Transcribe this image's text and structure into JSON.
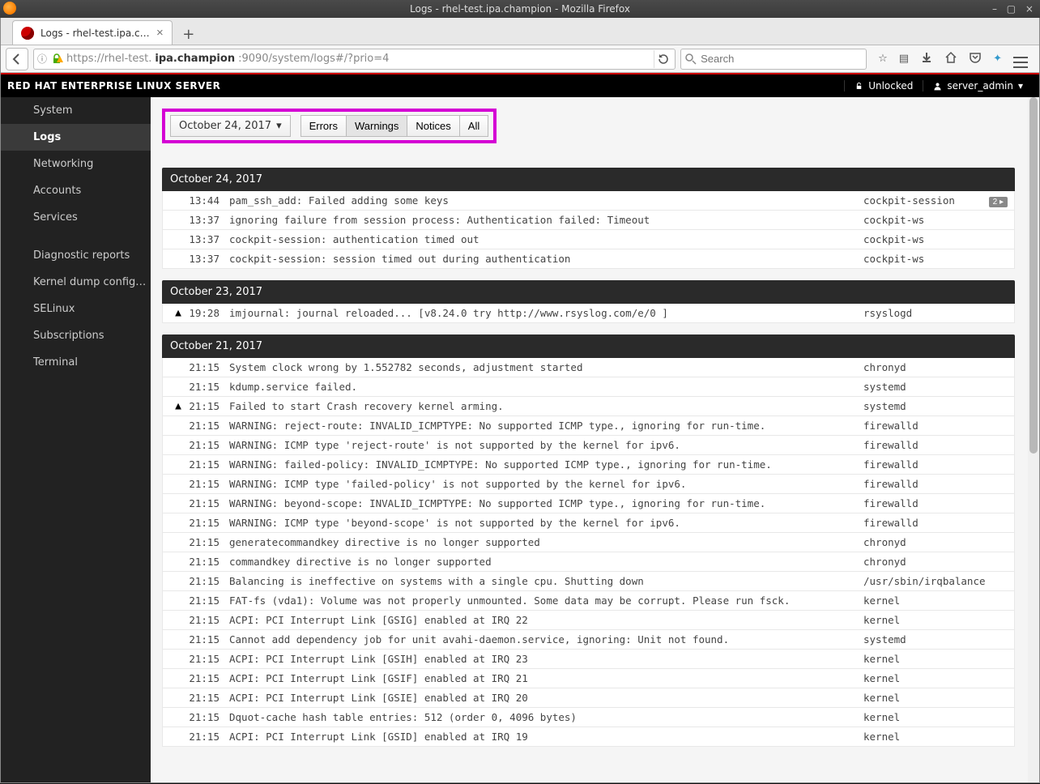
{
  "os": {
    "window_title": "Logs - rhel-test.ipa.champion - Mozilla Firefox"
  },
  "tabs": {
    "active_title": "Logs - rhel-test.ipa.cha"
  },
  "url": {
    "identity_info": "ⓘ",
    "scheme_prefix": "https://rhel-test.",
    "host_bold": "ipa.champion",
    "path_suffix": ":9090/system/logs#/?prio=4"
  },
  "search": {
    "placeholder": "Search"
  },
  "header": {
    "brand": "RED HAT ENTERPRISE LINUX SERVER",
    "lock_state": "Unlocked",
    "user": "server_admin"
  },
  "sidebar": {
    "items": [
      {
        "label": "System",
        "active": false
      },
      {
        "label": "Logs",
        "active": true
      },
      {
        "label": "Networking",
        "active": false
      },
      {
        "label": "Accounts",
        "active": false
      },
      {
        "label": "Services",
        "active": false
      }
    ],
    "items2": [
      {
        "label": "Diagnostic reports"
      },
      {
        "label": "Kernel dump configura…"
      },
      {
        "label": "SELinux"
      },
      {
        "label": "Subscriptions"
      },
      {
        "label": "Terminal"
      }
    ]
  },
  "filters": {
    "date_label": "October 24, 2017",
    "buttons": [
      "Errors",
      "Warnings",
      "Notices",
      "All"
    ]
  },
  "log_days": [
    {
      "heading": "October 24, 2017",
      "entries": [
        {
          "time": "13:44",
          "msg": "pam_ssh_add: Failed adding some keys",
          "src": "cockpit-session",
          "badge": "2 ▸"
        },
        {
          "time": "13:37",
          "msg": "ignoring failure from session process: Authentication failed: Timeout",
          "src": "cockpit-ws"
        },
        {
          "time": "13:37",
          "msg": "cockpit-session: authentication timed out",
          "src": "cockpit-ws"
        },
        {
          "time": "13:37",
          "msg": "cockpit-session: session timed out during authentication",
          "src": "cockpit-ws"
        }
      ]
    },
    {
      "heading": "October 23, 2017",
      "entries": [
        {
          "icon": "warn",
          "time": "19:28",
          "msg": "imjournal: journal reloaded... [v8.24.0 try http://www.rsyslog.com/e/0 ]",
          "src": "rsyslogd"
        }
      ]
    },
    {
      "heading": "October 21, 2017",
      "entries": [
        {
          "time": "21:15",
          "msg": "System clock wrong by 1.552782 seconds, adjustment started",
          "src": "chronyd"
        },
        {
          "time": "21:15",
          "msg": "kdump.service failed.",
          "src": "systemd"
        },
        {
          "icon": "warn",
          "time": "21:15",
          "msg": "Failed to start Crash recovery kernel arming.",
          "src": "systemd"
        },
        {
          "time": "21:15",
          "msg": "WARNING: reject-route: INVALID_ICMPTYPE: No supported ICMP type., ignoring for run-time.",
          "src": "firewalld"
        },
        {
          "time": "21:15",
          "msg": "WARNING: ICMP type 'reject-route' is not supported by the kernel for ipv6.",
          "src": "firewalld"
        },
        {
          "time": "21:15",
          "msg": "WARNING: failed-policy: INVALID_ICMPTYPE: No supported ICMP type., ignoring for run-time.",
          "src": "firewalld"
        },
        {
          "time": "21:15",
          "msg": "WARNING: ICMP type 'failed-policy' is not supported by the kernel for ipv6.",
          "src": "firewalld"
        },
        {
          "time": "21:15",
          "msg": "WARNING: beyond-scope: INVALID_ICMPTYPE: No supported ICMP type., ignoring for run-time.",
          "src": "firewalld"
        },
        {
          "time": "21:15",
          "msg": "WARNING: ICMP type 'beyond-scope' is not supported by the kernel for ipv6.",
          "src": "firewalld"
        },
        {
          "time": "21:15",
          "msg": "generatecommandkey directive is no longer supported",
          "src": "chronyd"
        },
        {
          "time": "21:15",
          "msg": "commandkey directive is no longer supported",
          "src": "chronyd"
        },
        {
          "time": "21:15",
          "msg": "Balancing is ineffective on systems with a single cpu. Shutting down",
          "src": "/usr/sbin/irqbalance"
        },
        {
          "time": "21:15",
          "msg": "FAT-fs (vda1): Volume was not properly unmounted. Some data may be corrupt. Please run fsck.",
          "src": "kernel"
        },
        {
          "time": "21:15",
          "msg": "ACPI: PCI Interrupt Link [GSIG] enabled at IRQ 22",
          "src": "kernel"
        },
        {
          "time": "21:15",
          "msg": "Cannot add dependency job for unit avahi-daemon.service, ignoring: Unit not found.",
          "src": "systemd"
        },
        {
          "time": "21:15",
          "msg": "ACPI: PCI Interrupt Link [GSIH] enabled at IRQ 23",
          "src": "kernel"
        },
        {
          "time": "21:15",
          "msg": "ACPI: PCI Interrupt Link [GSIF] enabled at IRQ 21",
          "src": "kernel"
        },
        {
          "time": "21:15",
          "msg": "ACPI: PCI Interrupt Link [GSIE] enabled at IRQ 20",
          "src": "kernel"
        },
        {
          "time": "21:15",
          "msg": "Dquot-cache hash table entries: 512 (order 0, 4096 bytes)",
          "src": "kernel"
        },
        {
          "time": "21:15",
          "msg": "ACPI: PCI Interrupt Link [GSID] enabled at IRQ 19",
          "src": "kernel"
        }
      ]
    }
  ]
}
